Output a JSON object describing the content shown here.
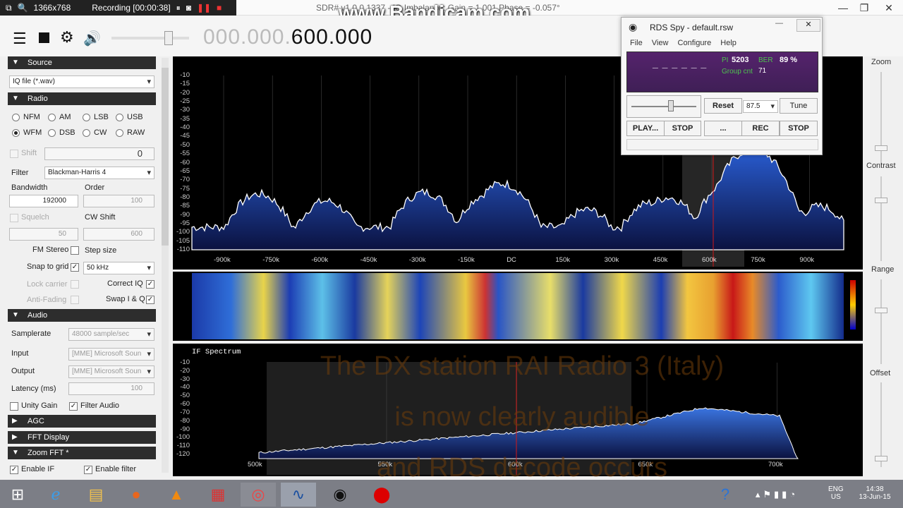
{
  "recording": {
    "resolution": "1366x768",
    "status": "Recording [00:00:38]"
  },
  "watermark": "www.Bandicam.com",
  "window": {
    "title": "SDR# v1.0.0.1337 - IQ Imbalance: Gain = 1.001 Phase = -0.057°"
  },
  "frequency": {
    "dim": "000.000.",
    "bright": "600.000"
  },
  "sections": {
    "source": "Source",
    "radio": "Radio",
    "audio": "Audio",
    "agc": "AGC",
    "fft": "FFT Display",
    "zoomfft": "Zoom FFT *"
  },
  "source": {
    "type": "IQ file (*.wav)"
  },
  "radio": {
    "modes": [
      "NFM",
      "AM",
      "LSB",
      "USB",
      "WFM",
      "DSB",
      "CW",
      "RAW"
    ],
    "shift_label": "Shift",
    "shift_value": "0",
    "filter_label": "Filter",
    "filter_value": "Blackman-Harris 4",
    "bandwidth_label": "Bandwidth",
    "bandwidth_value": "192000",
    "order_label": "Order",
    "order_value": "100",
    "squelch_label": "Squelch",
    "squelch_value": "50",
    "cwshift_label": "CW Shift",
    "cwshift_value": "600",
    "fmstereo": "FM Stereo",
    "stepsize": "Step size",
    "snap": "Snap to grid",
    "snap_value": "50 kHz",
    "lockcarrier": "Lock carrier",
    "correctiq": "Correct IQ",
    "antifading": "Anti-Fading",
    "swapiq": "Swap I & Q"
  },
  "audio": {
    "samplerate_label": "Samplerate",
    "samplerate_value": "48000 sample/sec",
    "input_label": "Input",
    "input_value": "[MME] Microsoft Soun",
    "output_label": "Output",
    "output_value": "[MME] Microsoft Soun",
    "latency_label": "Latency (ms)",
    "latency_value": "100",
    "unitygain": "Unity Gain",
    "filteraudio": "Filter Audio"
  },
  "zoomfft": {
    "enableif": "Enable IF",
    "enablefilter": "Enable filter"
  },
  "spectrum": {
    "y_ticks": [
      "-10",
      "-15",
      "-20",
      "-25",
      "-30",
      "-35",
      "-40",
      "-45",
      "-50",
      "-55",
      "-60",
      "-65",
      "-70",
      "-75",
      "-80",
      "-85",
      "-90",
      "-95",
      "-100",
      "-105",
      "-110"
    ],
    "x_ticks": [
      "-900k",
      "-750k",
      "-600k",
      "-450k",
      "-300k",
      "-150k",
      "DC",
      "150k",
      "300k",
      "450k",
      "600k",
      "750k",
      "900k"
    ]
  },
  "if_spectrum": {
    "title": "IF Spectrum",
    "y_ticks": [
      "-10",
      "-20",
      "-30",
      "-40",
      "-50",
      "-60",
      "-70",
      "-80",
      "-90",
      "-100",
      "-110",
      "-120"
    ],
    "x_ticks": [
      "500k",
      "550k",
      "600k",
      "650k",
      "700k"
    ]
  },
  "right_panel": {
    "zoom": "Zoom",
    "contrast": "Contrast",
    "range": "Range",
    "offset": "Offset"
  },
  "rds": {
    "title": "RDS Spy - default.rsw",
    "menu": [
      "File",
      "View",
      "Configure",
      "Help"
    ],
    "ps": "_ _ _ _ _ _",
    "pi_label": "PI",
    "pi_value": "5203",
    "ber_label": "BER",
    "ber_value": "89 %",
    "groupcnt_label": "Group cnt",
    "groupcnt_value": "71",
    "reset": "Reset",
    "freq": "87.5",
    "tune": "Tune",
    "play": "PLAY...",
    "stop": "STOP",
    "more": "...",
    "rec": "REC",
    "stop2": "STOP"
  },
  "overlay_text": [
    "The DX station RAI Radio 3 (Italy)",
    "is now clearly audible",
    "and RDS decode occurs"
  ],
  "taskbar": {
    "lang": "ENG",
    "region": "US",
    "time": "14:38",
    "date": "13-Jun-15"
  },
  "colors": {
    "spectrum_fill": "#1e3b8a",
    "spectrum_line": "#ffffff",
    "marker": "#d01818",
    "panel_dark": "#2d2d2d",
    "rds_display": "#4b2162"
  }
}
